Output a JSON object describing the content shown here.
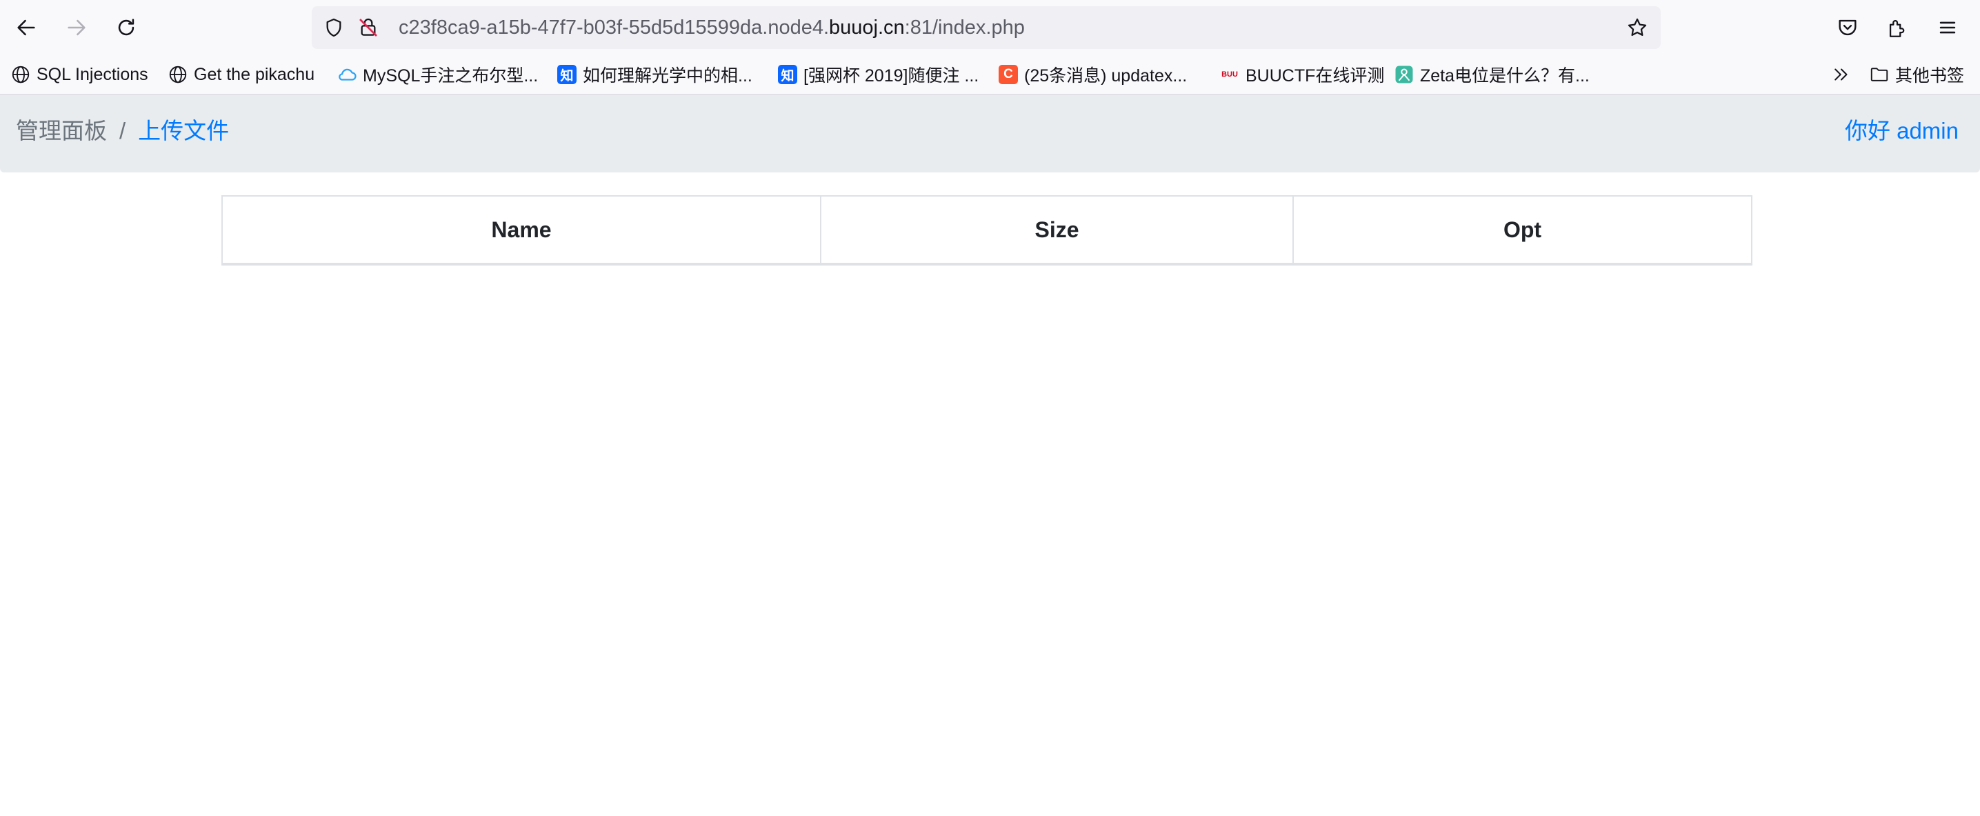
{
  "browser": {
    "url_prefix": "c23f8ca9-a15b-47f7-b03f-55d5d15599da.node4.",
    "url_domain": "buuoj.cn",
    "url_suffix": ":81/index.php"
  },
  "bookmarks": {
    "items": [
      {
        "label": "SQL Injections",
        "icon": "globe-icon"
      },
      {
        "label": "Get the pikachu",
        "icon": "globe-icon"
      },
      {
        "label": "MySQL手注之布尔型...",
        "icon": "cloud-icon"
      },
      {
        "label": "如何理解光学中的相...",
        "icon": "zhihu-icon",
        "badge": "知"
      },
      {
        "label": "[强网杯 2019]随便注 ...",
        "icon": "zhihu-icon",
        "badge": "知"
      },
      {
        "label": "(25条消息) updatex...",
        "icon": "csdn-icon",
        "badge": "C"
      },
      {
        "label": "BUUCTF在线评测",
        "icon": "buuctf-icon",
        "badge": "BUU"
      },
      {
        "label": "Zeta电位是什么？有...",
        "icon": "person-icon"
      }
    ],
    "other_label": "其他书签"
  },
  "page": {
    "breadcrumb": {
      "home": "管理面板",
      "separator": "/",
      "current": "上传文件"
    },
    "greeting": "你好 admin",
    "table": {
      "headers": [
        "Name",
        "Size",
        "Opt"
      ],
      "rows": []
    }
  },
  "colors": {
    "accent": "#007bff",
    "header_bg": "#e9ecef",
    "muted": "#6c757d"
  }
}
